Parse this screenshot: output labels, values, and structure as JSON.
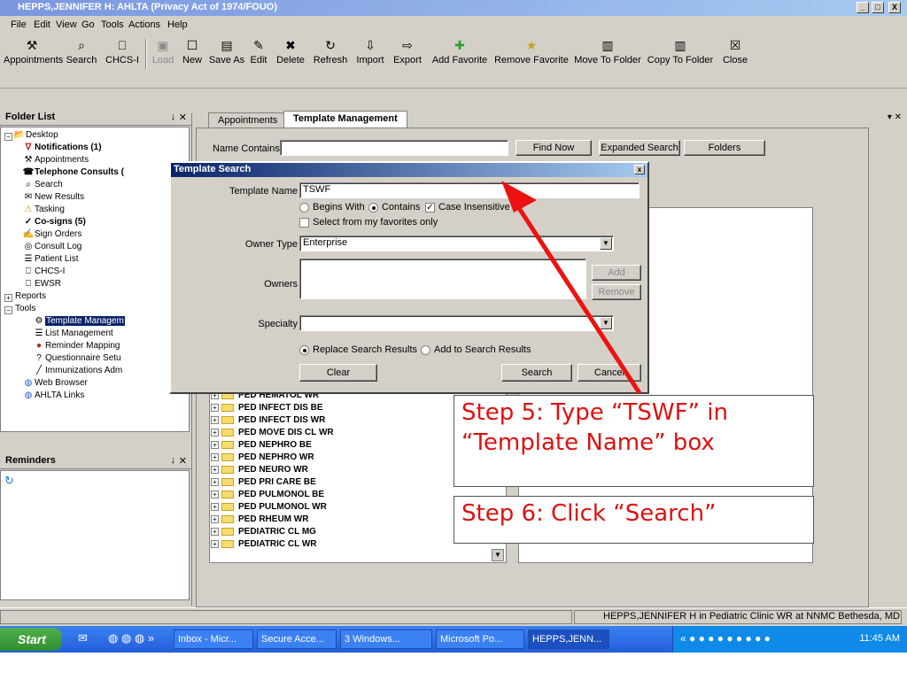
{
  "window": {
    "title": "HEPPS,JENNIFER H: AHLTA  (Privacy Act of 1974/FOUO)",
    "controls": [
      "_",
      "□",
      "X"
    ]
  },
  "menu": [
    "File",
    "Edit",
    "View",
    "Go",
    "Tools",
    "Actions",
    "Help"
  ],
  "toolbar": [
    {
      "label": "Appointments",
      "icon": "appointments-icon",
      "glyph": "⚒",
      "enabled": true
    },
    {
      "label": "Search",
      "icon": "search-icon",
      "glyph": "⌕",
      "enabled": true
    },
    {
      "label": "CHCS-I",
      "icon": "chcs-icon",
      "glyph": "⎕",
      "enabled": true
    },
    {
      "label": "Load",
      "icon": "load-icon",
      "glyph": "▣",
      "enabled": false
    },
    {
      "label": "New",
      "icon": "new-icon",
      "glyph": "☐",
      "enabled": true
    },
    {
      "label": "Save As",
      "icon": "save-as-icon",
      "glyph": "▤",
      "enabled": true
    },
    {
      "label": "Edit",
      "icon": "edit-icon",
      "glyph": "✎",
      "enabled": true
    },
    {
      "label": "Delete",
      "icon": "delete-icon",
      "glyph": "✖",
      "enabled": true
    },
    {
      "label": "Refresh",
      "icon": "refresh-icon",
      "glyph": "↻",
      "enabled": true
    },
    {
      "label": "Import",
      "icon": "import-icon",
      "glyph": "⇩",
      "enabled": true
    },
    {
      "label": "Export",
      "icon": "export-icon",
      "glyph": "⇨",
      "enabled": true
    },
    {
      "label": "Add Favorite",
      "icon": "add-favorite-icon",
      "glyph": "✚",
      "enabled": true
    },
    {
      "label": "Remove Favorite",
      "icon": "remove-favorite-icon",
      "glyph": "★",
      "enabled": true
    },
    {
      "label": "Move To Folder",
      "icon": "move-to-folder-icon",
      "glyph": "▥",
      "enabled": true
    },
    {
      "label": "Copy To Folder",
      "icon": "copy-to-folder-icon",
      "glyph": "▥",
      "enabled": true
    },
    {
      "label": "Close",
      "icon": "close-icon",
      "glyph": "☒",
      "enabled": true
    }
  ],
  "folder_list": {
    "title": "Folder List",
    "items": [
      {
        "label": "Desktop",
        "bold": false,
        "selected": false,
        "icon": "desktop-folder-icon",
        "glyph": "📂"
      },
      {
        "label": "Notifications (1)",
        "bold": true,
        "selected": false,
        "icon": "notifications-icon",
        "glyph": "∇"
      },
      {
        "label": "Appointments",
        "bold": false,
        "selected": false,
        "icon": "appointments-icon",
        "glyph": "⚒"
      },
      {
        "label": "Telephone Consults (",
        "bold": true,
        "selected": false,
        "icon": "telephone-consults-icon",
        "glyph": "☎"
      },
      {
        "label": "Search",
        "bold": false,
        "selected": false,
        "icon": "search-icon",
        "glyph": "⌕"
      },
      {
        "label": "New Results",
        "bold": false,
        "selected": false,
        "icon": "new-results-icon",
        "glyph": "✉"
      },
      {
        "label": "Tasking",
        "bold": false,
        "selected": false,
        "icon": "tasking-icon",
        "glyph": "⚠"
      },
      {
        "label": "Co-signs (5)",
        "bold": true,
        "selected": false,
        "icon": "co-signs-icon",
        "glyph": "✓"
      },
      {
        "label": "Sign Orders",
        "bold": false,
        "selected": false,
        "icon": "sign-orders-icon",
        "glyph": "✍"
      },
      {
        "label": "Consult Log",
        "bold": false,
        "selected": false,
        "icon": "consult-log-icon",
        "glyph": "◎"
      },
      {
        "label": "Patient List",
        "bold": false,
        "selected": false,
        "icon": "patient-list-icon",
        "glyph": "☰"
      },
      {
        "label": "CHCS-I",
        "bold": false,
        "selected": false,
        "icon": "chcs-icon",
        "glyph": "⎕"
      },
      {
        "label": "EWSR",
        "bold": false,
        "selected": false,
        "icon": "ewsr-icon",
        "glyph": "⎕"
      },
      {
        "label": "Reports",
        "bold": false,
        "selected": false,
        "icon": "reports-expander-icon",
        "glyph": ""
      },
      {
        "label": "Tools",
        "bold": false,
        "selected": false,
        "icon": "tools-expander-icon",
        "glyph": ""
      },
      {
        "label": "Template Managem",
        "bold": false,
        "selected": true,
        "icon": "template-management-icon",
        "glyph": "⚙"
      },
      {
        "label": "List Management",
        "bold": false,
        "selected": false,
        "icon": "list-management-icon",
        "glyph": "☰"
      },
      {
        "label": "Reminder Mapping",
        "bold": false,
        "selected": false,
        "icon": "reminder-mapping-icon",
        "glyph": "●"
      },
      {
        "label": "Questionnaire Setu",
        "bold": false,
        "selected": false,
        "icon": "questionnaire-icon",
        "glyph": "?"
      },
      {
        "label": "Immunizations Adm",
        "bold": false,
        "selected": false,
        "icon": "immunizations-icon",
        "glyph": "╱"
      },
      {
        "label": "Web Browser",
        "bold": false,
        "selected": false,
        "icon": "web-browser-icon",
        "glyph": "◍"
      },
      {
        "label": "AHLTA Links",
        "bold": false,
        "selected": false,
        "icon": "ahlta-links-icon",
        "glyph": "◍"
      }
    ]
  },
  "reminders": {
    "title": "Reminders"
  },
  "tabs": [
    "Appointments",
    "Template Management"
  ],
  "search_bar": {
    "name_contains_label": "Name Contains:",
    "name_contains_value": "",
    "find_now": "Find Now",
    "expanded_search": "Expanded Search",
    "folders": "Folders"
  },
  "results": [
    "PED HEMATOL WR",
    "PED INFECT DIS BE",
    "PED INFECT DIS WR",
    "PED MOVE DIS CL WR",
    "PED NEPHRO BE",
    "PED NEPHRO WR",
    "PED NEURO WR",
    "PED PRI CARE BE",
    "PED PULMONOL BE",
    "PED PULMONOL WR",
    "PED RHEUM WR",
    "PEDIATRIC CL MG",
    "PEDIATRIC CL WR"
  ],
  "dialog": {
    "title": "Template Search",
    "close": "x",
    "template_name_label": "Template Name",
    "template_name_value": "TSWF",
    "begins_with": "Begins With",
    "contains": "Contains",
    "case_insensitive": "Case Insensitive",
    "favorites_only": "Select from my favorites only",
    "owner_type_label": "Owner Type",
    "owner_type_value": "Enterprise",
    "owners_label": "Owners",
    "add": "Add",
    "remove": "Remove",
    "specialty_label": "Specialty",
    "specialty_value": "",
    "replace_results": "Replace Search Results",
    "add_results": "Add to Search Results",
    "clear": "Clear",
    "search": "Search",
    "cancel": "Cancel"
  },
  "annotations": {
    "step5": "Step 5: Type “TSWF” in “Template Name” box",
    "step6": "Step 6: Click “Search”",
    "arrow_color": "#ee1111"
  },
  "status": "HEPPS,JENNIFER H in Pediatric Clinic WR at NNMC Bethesda, MD",
  "taskbar": {
    "start": "Start",
    "tasks": [
      "Inbox - Micr...",
      "Secure Acce...",
      "3 Windows...",
      "Microsoft Po...",
      "HEPPS,JENN..."
    ],
    "clock": "11:45 AM"
  }
}
